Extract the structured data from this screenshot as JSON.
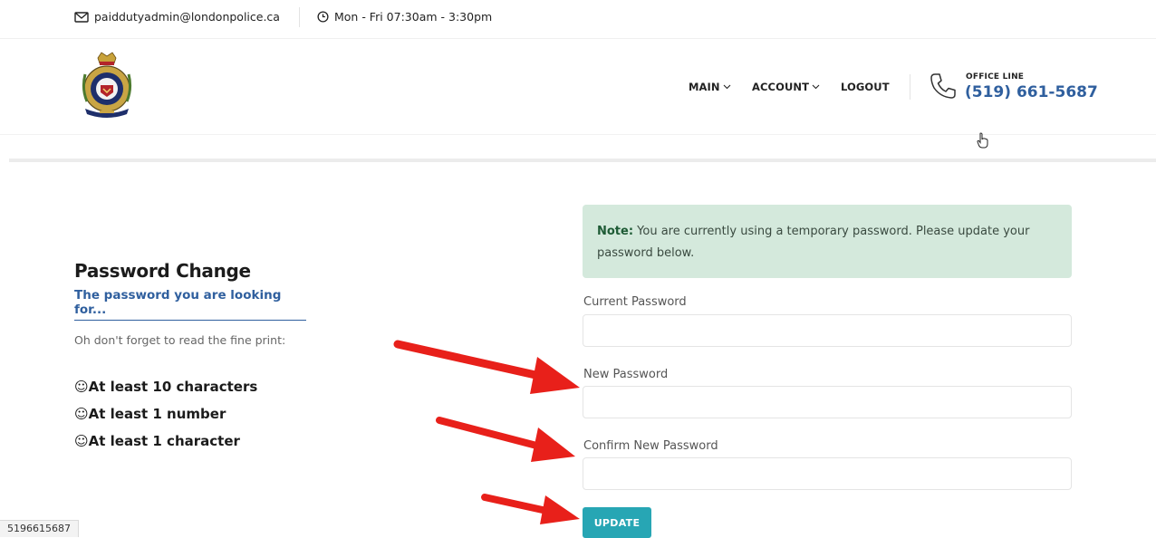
{
  "topbar": {
    "email": "paiddutyadmin@londonpolice.ca",
    "hours": "Mon - Fri 07:30am - 3:30pm"
  },
  "nav": {
    "main": "MAIN",
    "account": "ACCOUNT",
    "logout": "LOGOUT",
    "office_label": "OFFICE LINE",
    "office_number": "(519) 661-5687"
  },
  "page": {
    "title": "Password Change",
    "subtitle": "The password you are looking for...",
    "fineprint": "Oh don't forget to read the fine print:",
    "requirements": [
      "☺At least 10 characters",
      "☺At least 1 number",
      "☺At least 1 character"
    ]
  },
  "form": {
    "note_label": "Note:",
    "note_text": " You are currently using a temporary password. Please update your password below.",
    "current_label": "Current Password",
    "new_label": "New Password",
    "confirm_label": "Confirm New Password",
    "current_value": "",
    "new_value": "",
    "confirm_value": "",
    "update_label": "UPDATE"
  },
  "statusbar": {
    "url": "5196615687"
  },
  "colors": {
    "accent": "#2f5f9e",
    "button": "#27a6b4",
    "note_bg": "#d4e9dc",
    "arrow": "#e8201a"
  }
}
